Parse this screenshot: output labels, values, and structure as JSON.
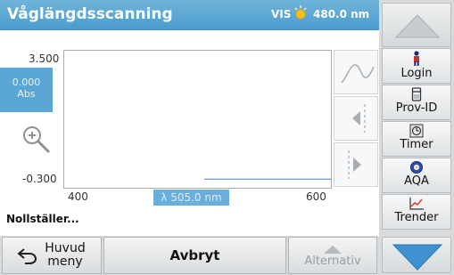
{
  "header": {
    "title": "Våglängdsscanning",
    "mode": "VIS",
    "wavelength": "480.0 nm"
  },
  "chart_data": {
    "type": "line",
    "title": "",
    "xlabel": "",
    "ylabel": "",
    "xlim": [
      400,
      600
    ],
    "ylim": [
      -0.3,
      3.5
    ],
    "x_tick_labels": [
      "400",
      "600"
    ],
    "y_tick_labels": [
      "3.500",
      "-0.300"
    ],
    "series": [
      {
        "x": [
          505,
          600
        ],
        "y": [
          -0.06,
          -0.06
        ]
      }
    ]
  },
  "readout": {
    "value": "0.000",
    "unit": "Abs"
  },
  "cursor": {
    "label": "λ 505.0 nm"
  },
  "status": "Nollställer...",
  "sidebar": {
    "items": [
      {
        "label": "Login",
        "icon": "person-icon"
      },
      {
        "label": "Prov-ID",
        "icon": "sample-icon"
      },
      {
        "label": "Timer",
        "icon": "timer-icon"
      },
      {
        "label": "AQA",
        "icon": "aqa-icon"
      },
      {
        "label": "Trender",
        "icon": "trend-icon"
      }
    ]
  },
  "bottom": {
    "main_menu": "Huvud meny",
    "cancel": "Avbryt",
    "options": "Alternativ"
  },
  "colors": {
    "accent": "#4a9ccd",
    "trace": "#3b7fd0"
  }
}
